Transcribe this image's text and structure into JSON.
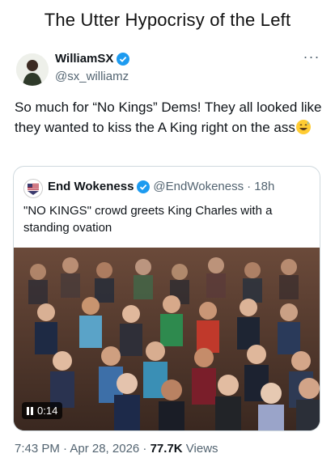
{
  "headline": "The Utter Hypocrisy of the Left",
  "tweet": {
    "author_name": "WilliamSX",
    "author_handle": "@sx_williamz",
    "text": "So much for “No Kings” Dems! They all looked like they wanted to kiss the A King right on the ass",
    "emoji": "grinning-sweat-emoji",
    "timestamp": "7:43 PM · Apr 28, 2026 · ",
    "views_count": "77.7K",
    "views_label": " Views"
  },
  "quoted": {
    "author_name": "End Wokeness",
    "author_handle": "@EndWokeness",
    "age": "· 18h",
    "text": "\"NO KINGS\" crowd greets King Charles with a standing ovation",
    "video_duration": "0:14"
  },
  "colors": {
    "verified": "#1d9bf0",
    "secondary_text": "#536471",
    "border": "#cfd9de"
  }
}
